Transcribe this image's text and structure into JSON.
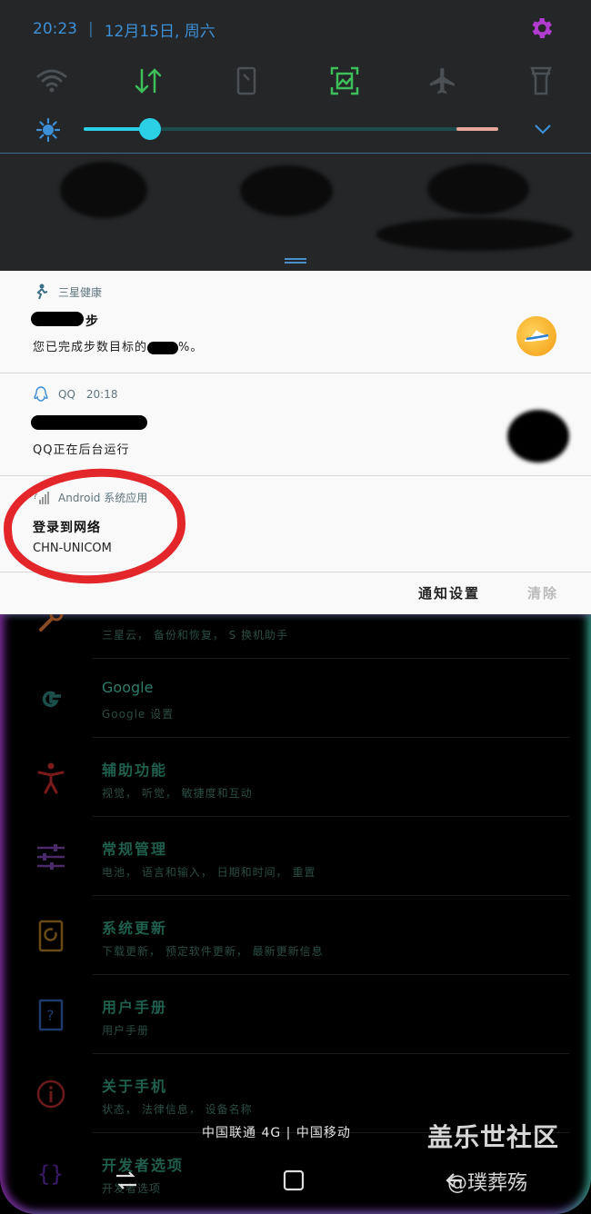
{
  "status_bar": {
    "time": "20:23",
    "date": "12月15日, 周六"
  },
  "quick_toggles": [
    "wifi-icon",
    "mobile-data-icon",
    "auto-rotate-icon",
    "screenshot-icon",
    "airplane-mode-icon",
    "flashlight-icon"
  ],
  "brightness": {
    "level": 0.16
  },
  "notifications": [
    {
      "app": "三星健康",
      "title_suffix": "步",
      "text_prefix": "您已完成步数目标的",
      "text_suffix": "%。"
    },
    {
      "app": "QQ",
      "time": "20:18",
      "text": "QQ正在后台运行"
    },
    {
      "app": "Android 系统应用",
      "title": "登录到网络",
      "text": "CHN-UNICOM"
    }
  ],
  "actions": {
    "settings": "通知设置",
    "clear": "清除"
  },
  "settings_list": [
    {
      "icon": "wrench-icon",
      "title": "",
      "subtitle": "三星云， 备份和恢复， S 换机助手"
    },
    {
      "icon": "google-icon",
      "title": "Google",
      "subtitle": "Google 设置"
    },
    {
      "icon": "accessibility-icon",
      "title": "辅助功能",
      "subtitle": "视觉， 听觉， 敏捷度和互动"
    },
    {
      "icon": "sliders-icon",
      "title": "常规管理",
      "subtitle": "电池， 语言和输入， 日期和时间， 重置"
    },
    {
      "icon": "software-update-icon",
      "title": "系统更新",
      "subtitle": "下载更新， 预定软件更新， 最新更新信息"
    },
    {
      "icon": "manual-icon",
      "title": "用户手册",
      "subtitle": "用户手册"
    },
    {
      "icon": "info-icon",
      "title": "关于手机",
      "subtitle": "状态， 法律信息， 设备名称"
    },
    {
      "icon": "developer-options-icon",
      "title": "开发者选项",
      "subtitle": "开发者选项"
    }
  ],
  "carrier_text": "中国联通 4G  |  中国移动",
  "watermark": {
    "line1": "盖乐世社区",
    "line2": "@璞葬殇"
  },
  "colors": {
    "quick_panel_bg": "#242628",
    "accent_blue": "#3d8fd6",
    "gear": "#b23bd0",
    "brightness": "#2bd0e6",
    "active_toggle": "#3fbf5a",
    "annotation_red": "#e3262a"
  }
}
